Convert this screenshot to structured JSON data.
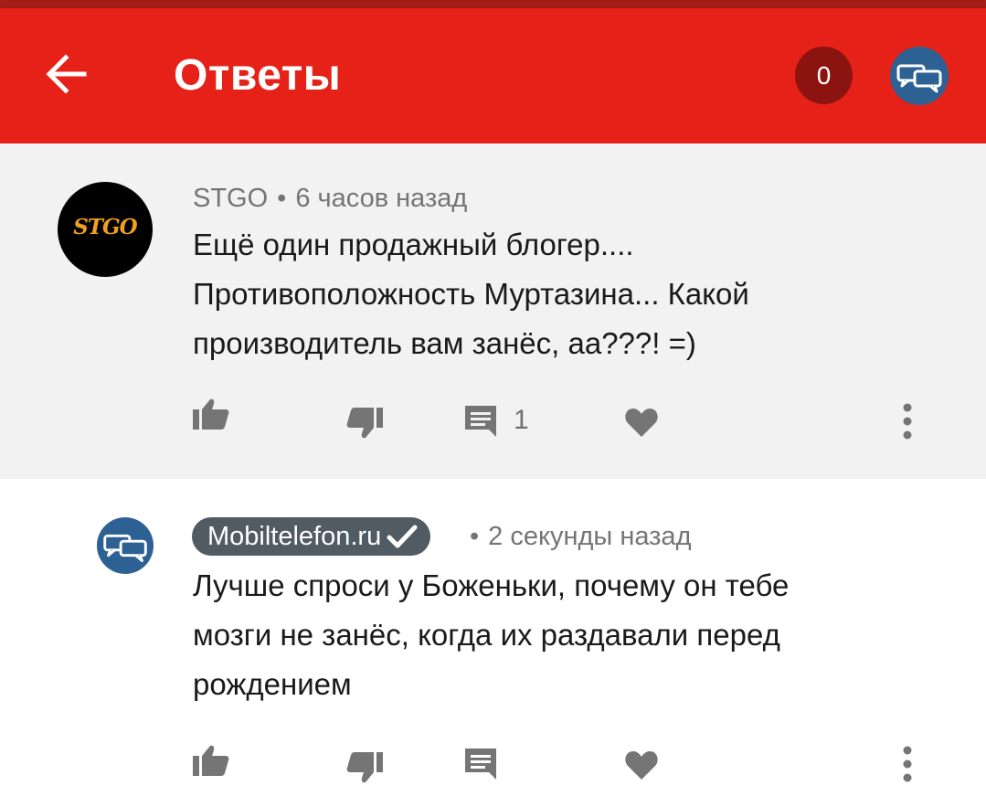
{
  "header": {
    "title": "Ответы",
    "notification_count": "0",
    "bar_color": "#e62117",
    "icons": [
      "back-arrow-icon",
      "chat-bubbles-icon"
    ]
  },
  "comments": [
    {
      "author": "STGO",
      "avatar_text": "STGO",
      "time": "6 часов назад",
      "lines": [
        "Ещё один продажный блогер....",
        "Противоположность Муртазина... Какой",
        "производитель вам занёс, аа???! =)"
      ],
      "reply_count": "1",
      "background": "#f2f2f2"
    },
    {
      "author": "Mobiltelefon.ru",
      "verified": true,
      "time": "2 секунды назад",
      "lines": [
        "Лучше спроси у Боженьки, почему он тебе",
        "мозги не занёс, когда их раздавали перед",
        "рождением"
      ],
      "background": "#ffffff"
    }
  ],
  "dot_separator": "•"
}
